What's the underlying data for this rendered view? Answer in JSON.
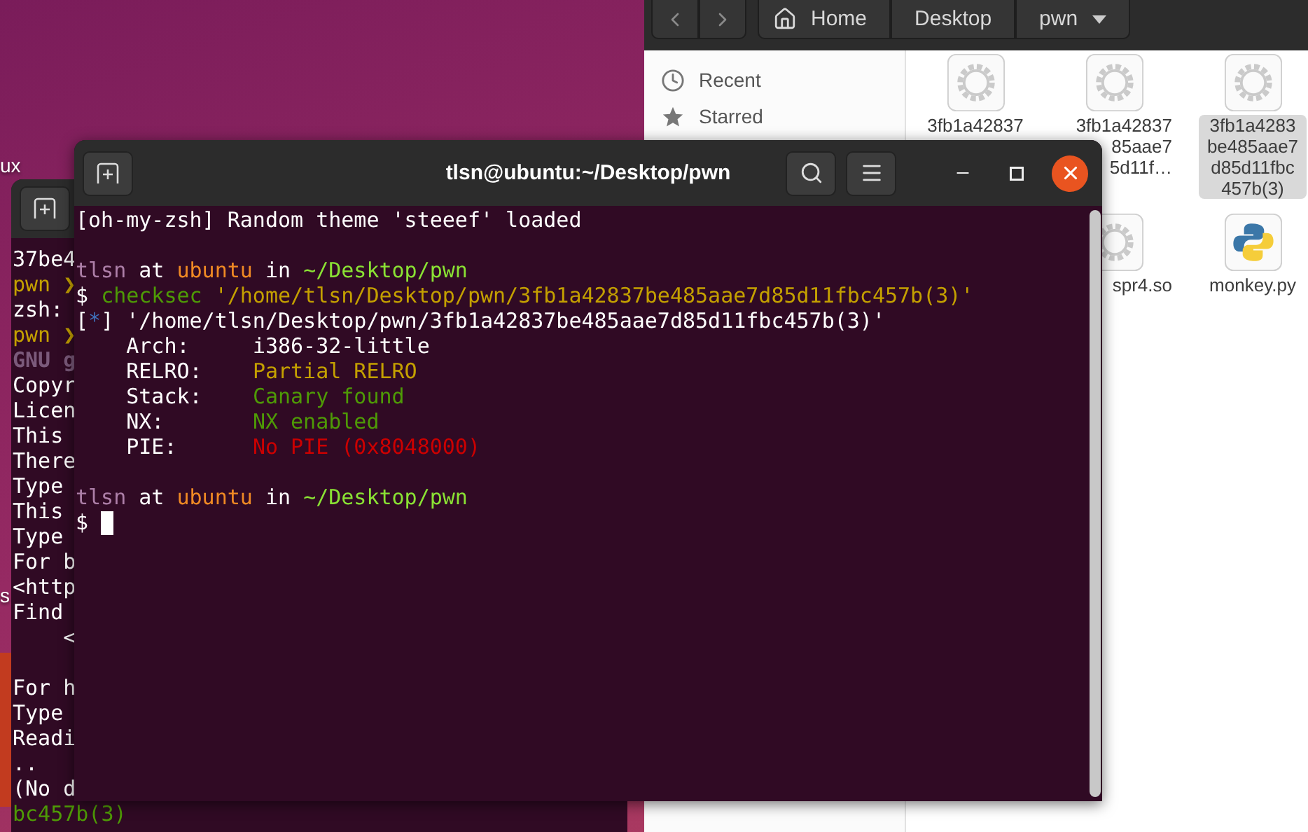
{
  "desktop": {
    "labels": [
      "ux",
      "s"
    ]
  },
  "file_manager": {
    "path": [
      {
        "label": "Home",
        "kind": "home"
      },
      {
        "label": "Desktop",
        "kind": "folder"
      },
      {
        "label": "pwn",
        "kind": "current"
      }
    ],
    "sidebar": [
      {
        "label": "Recent",
        "kind": "recent"
      },
      {
        "label": "Starred",
        "kind": "starred"
      }
    ],
    "file_rows": [
      {
        "files": [
          {
            "lines": [
              "3fb1a42837"
            ],
            "kind": "binary",
            "selected": false
          },
          {
            "lines": [
              "3fb1a42837",
              "85aae7",
              "5d11f…"
            ],
            "kind": "binary-covered",
            "selected": false
          },
          {
            "lines": [
              "3fb1a4283",
              "be485aae7",
              "d85d11fbc",
              "457b(3)"
            ],
            "kind": "binary",
            "selected": true
          }
        ]
      },
      {
        "files": [
          {
            "lines": [
              "spr4.so"
            ],
            "kind": "binary-covered",
            "selected": false
          },
          {
            "lines": [
              "monkey.py"
            ],
            "kind": "python",
            "selected": false
          }
        ]
      }
    ]
  },
  "back_terminal": {
    "lines": [
      {
        "text": "37be4",
        "kind": "plain"
      },
      {
        "text": "pwn ❯",
        "kind": "prompt"
      },
      {
        "text": "zsh:",
        "kind": "plain"
      },
      {
        "text": "pwn ❯",
        "kind": "prompt"
      },
      {
        "text": "GNU g",
        "kind": "dim"
      },
      {
        "text": "Copyr",
        "kind": "plain"
      },
      {
        "text": "Licen",
        "kind": "plain"
      },
      {
        "text": "This",
        "kind": "plain"
      },
      {
        "text": "There",
        "kind": "plain"
      },
      {
        "text": "Type",
        "kind": "plain"
      },
      {
        "text": "This",
        "kind": "plain"
      },
      {
        "text": "Type",
        "kind": "plain"
      },
      {
        "text": "For b",
        "kind": "plain"
      },
      {
        "text": "<http",
        "kind": "plain"
      },
      {
        "text": "Find",
        "kind": "plain"
      },
      {
        "text": "    <",
        "kind": "plain"
      },
      {
        "kind": "blank"
      },
      {
        "text": "For h",
        "kind": "plain"
      },
      {
        "text": "Type",
        "kind": "plain"
      },
      {
        "text": "Readi",
        "kind": "plain"
      },
      {
        "text": "..",
        "kind": "plain"
      },
      {
        "text": "(No d",
        "kind": "plain"
      },
      {
        "text": "bc457b(3)",
        "kind": "green"
      }
    ]
  },
  "terminal": {
    "title": "tlsn@ubuntu:~/Desktop/pwn",
    "lines": [
      {
        "kind": "output",
        "segments": [
          {
            "text": "[oh-my-zsh] Random theme 'steeef' loaded",
            "kind": "plain"
          }
        ]
      },
      {
        "kind": "blank"
      },
      {
        "kind": "output",
        "segments": [
          {
            "text": "tlsn",
            "kind": "user"
          },
          {
            "text": " at ",
            "kind": "plain"
          },
          {
            "text": "ubuntu",
            "kind": "host"
          },
          {
            "text": " in ",
            "kind": "plain"
          },
          {
            "text": "~/Desktop/pwn",
            "kind": "path"
          }
        ]
      },
      {
        "kind": "output",
        "segments": [
          {
            "text": "$ ",
            "kind": "plain"
          },
          {
            "text": "checksec",
            "kind": "command"
          },
          {
            "text": " '/home/tlsn/Desktop/pwn/3fb1a42837be485aae7d85d11fbc457b(3)'",
            "kind": "argument"
          }
        ]
      },
      {
        "kind": "output",
        "segments": [
          {
            "text": "[",
            "kind": "plain"
          },
          {
            "text": "*",
            "kind": "marker"
          },
          {
            "text": "] '/home/tlsn/Desktop/pwn/3fb1a42837be485aae7d85d11fbc457b(3)'",
            "kind": "plain"
          }
        ]
      },
      {
        "kind": "output",
        "segments": [
          {
            "text": "    Arch:     ",
            "kind": "plain"
          },
          {
            "text": "i386-32-little",
            "kind": "plain"
          }
        ]
      },
      {
        "kind": "output",
        "segments": [
          {
            "text": "    RELRO:    ",
            "kind": "plain"
          },
          {
            "text": "Partial RELRO",
            "kind": "partial"
          }
        ]
      },
      {
        "kind": "output",
        "segments": [
          {
            "text": "    Stack:    ",
            "kind": "plain"
          },
          {
            "text": "Canary found",
            "kind": "good"
          }
        ]
      },
      {
        "kind": "output",
        "segments": [
          {
            "text": "    NX:       ",
            "kind": "plain"
          },
          {
            "text": "NX enabled",
            "kind": "good"
          }
        ]
      },
      {
        "kind": "output",
        "segments": [
          {
            "text": "    PIE:      ",
            "kind": "plain"
          },
          {
            "text": "No PIE (0x8048000)",
            "kind": "bad"
          }
        ]
      },
      {
        "kind": "blank"
      },
      {
        "kind": "output",
        "segments": [
          {
            "text": "tlsn",
            "kind": "user"
          },
          {
            "text": " at ",
            "kind": "plain"
          },
          {
            "text": "ubuntu",
            "kind": "host"
          },
          {
            "text": " in ",
            "kind": "plain"
          },
          {
            "text": "~/Desktop/pwn",
            "kind": "path"
          }
        ]
      },
      {
        "kind": "input",
        "segments": [
          {
            "text": "$ ",
            "kind": "plain"
          }
        ]
      }
    ]
  }
}
